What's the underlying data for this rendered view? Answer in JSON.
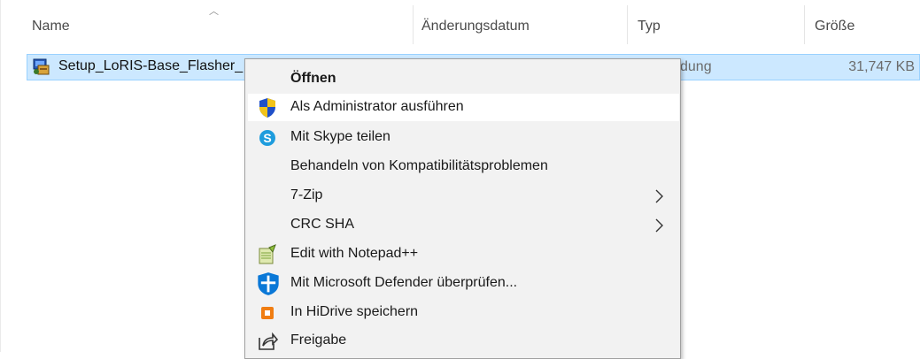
{
  "columns": {
    "name": "Name",
    "date": "Änderungsdatum",
    "type": "Typ",
    "size": "Größe"
  },
  "file": {
    "name": "Setup_LoRIS-Base_Flasher_",
    "type_partial": "dung",
    "size": "31,747 KB"
  },
  "context_menu": {
    "items": [
      {
        "label": "Öffnen",
        "icon": "none",
        "bold": true
      },
      {
        "label": "Als Administrator ausführen",
        "icon": "uac-shield-icon"
      },
      {
        "label": "Mit Skype teilen",
        "icon": "skype-icon"
      },
      {
        "label": "Behandeln von Kompatibilitätsproblemen",
        "icon": "none"
      },
      {
        "label": "7-Zip",
        "icon": "none",
        "submenu": true
      },
      {
        "label": "CRC SHA",
        "icon": "none",
        "submenu": true
      },
      {
        "label": "Edit with Notepad++",
        "icon": "notepadpp-icon"
      },
      {
        "label": "Mit Microsoft Defender überprüfen...",
        "icon": "defender-icon"
      },
      {
        "label": "In HiDrive speichern",
        "icon": "hidrive-icon"
      },
      {
        "label": "Freigabe",
        "icon": "share-icon"
      }
    ]
  },
  "colors": {
    "selection": "#cce8ff",
    "selection_border": "#99d1ff",
    "menu_bg": "#f2f2f2",
    "highlight": "#ffffff"
  }
}
